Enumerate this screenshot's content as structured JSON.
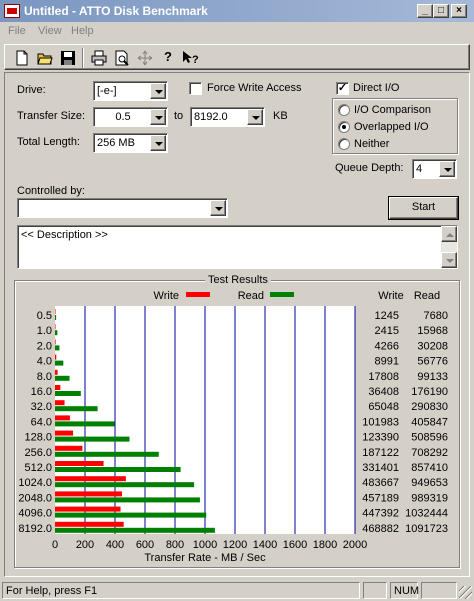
{
  "window": {
    "title": "Untitled - ATTO Disk Benchmark"
  },
  "menu": [
    "File",
    "View",
    "Help"
  ],
  "toolbar_icons": [
    "new-icon",
    "open-icon",
    "save-icon",
    "print-icon",
    "print-preview-icon",
    "move-icon",
    "help-icon",
    "context-help-icon"
  ],
  "form": {
    "drive_label": "Drive:",
    "drive_value": "[-e-]",
    "force_write_label": "Force Write Access",
    "force_write_checked": false,
    "direct_io_label": "Direct I/O",
    "direct_io_checked": true,
    "transfer_size_label": "Transfer Size:",
    "transfer_from": "0.5",
    "to_label": "to",
    "transfer_to": "8192.0",
    "kb_label": "KB",
    "total_length_label": "Total Length:",
    "total_length_value": "256 MB",
    "io_comparison_label": "I/O Comparison",
    "overlapped_io_label": "Overlapped I/O",
    "neither_label": "Neither",
    "selected_io_mode": "Overlapped I/O",
    "queue_depth_label": "Queue Depth:",
    "queue_depth_value": "4",
    "controlled_by_label": "Controlled by:",
    "controlled_by_value": "",
    "start_label": "Start",
    "description_text": "<< Description >>"
  },
  "results": {
    "group_title": "Test Results",
    "write_col": "Write",
    "read_col": "Read"
  },
  "chart_data": {
    "type": "bar",
    "orientation": "horizontal",
    "categories": [
      "0.5",
      "1.0",
      "2.0",
      "4.0",
      "8.0",
      "16.0",
      "32.0",
      "64.0",
      "128.0",
      "256.0",
      "512.0",
      "1024.0",
      "2048.0",
      "4096.0",
      "8192.0"
    ],
    "series": [
      {
        "name": "Write",
        "color": "#ff0000",
        "values": [
          1245,
          2415,
          4266,
          8991,
          17808,
          36408,
          65048,
          101983,
          123390,
          187122,
          331401,
          483667,
          457189,
          447392,
          468882
        ]
      },
      {
        "name": "Read",
        "color": "#008000",
        "values": [
          7680,
          15968,
          30208,
          56776,
          99133,
          176190,
          290830,
          405847,
          508596,
          708292,
          857410,
          949653,
          989319,
          1032444,
          1091723
        ]
      }
    ],
    "write_text": [
      "1245",
      "2415",
      "4266",
      "8991",
      "17808",
      "36408",
      "65048",
      "101983",
      "123390",
      "187122",
      "331401",
      "483667",
      "457189",
      "447392",
      "468882"
    ],
    "read_text": [
      "7680",
      "15968",
      "30208",
      "56776",
      "99133",
      "176190",
      "290830",
      "405847",
      "508596",
      "708292",
      "857410",
      "949653",
      "989319",
      "1032444",
      "1091723"
    ],
    "xticks": [
      "0",
      "200",
      "400",
      "600",
      "800",
      "1000",
      "1200",
      "1400",
      "1600",
      "1800",
      "2000"
    ],
    "xlim": [
      0,
      2000
    ],
    "xlabel": "Transfer Rate - MB / Sec",
    "grid": true,
    "legend_position": "top"
  },
  "status": {
    "help_text": "For Help, press F1",
    "num_indicator": "NUM"
  }
}
